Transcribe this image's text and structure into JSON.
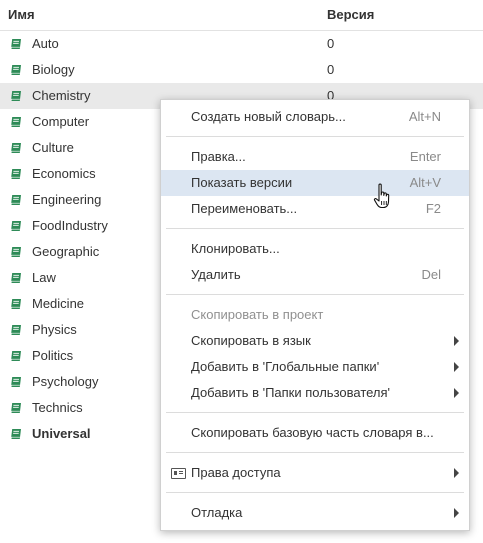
{
  "header": {
    "name_col": "Имя",
    "version_col": "Версия"
  },
  "colors": {
    "book": "#2e8b57",
    "selected_row": "#e9e9e9",
    "highlight": "#dce6f2"
  },
  "rows": [
    {
      "name": "Auto",
      "version": "0"
    },
    {
      "name": "Biology",
      "version": "0"
    },
    {
      "name": "Chemistry",
      "version": "0",
      "selected": true
    },
    {
      "name": "Computer",
      "version": ""
    },
    {
      "name": "Culture",
      "version": ""
    },
    {
      "name": "Economics",
      "version": ""
    },
    {
      "name": "Engineering",
      "version": ""
    },
    {
      "name": "FoodIndustry",
      "version": ""
    },
    {
      "name": "Geographic",
      "version": ""
    },
    {
      "name": "Law",
      "version": ""
    },
    {
      "name": "Medicine",
      "version": ""
    },
    {
      "name": "Physics",
      "version": ""
    },
    {
      "name": "Politics",
      "version": ""
    },
    {
      "name": "Psychology",
      "version": ""
    },
    {
      "name": "Technics",
      "version": ""
    },
    {
      "name": "Universal",
      "version": "",
      "bold": true
    }
  ],
  "menu": {
    "create": {
      "label": "Создать новый словарь...",
      "shortcut": "Alt+N"
    },
    "edit": {
      "label": "Правка...",
      "shortcut": "Enter"
    },
    "show_versions": {
      "label": "Показать версии",
      "shortcut": "Alt+V"
    },
    "rename": {
      "label": "Переименовать...",
      "shortcut": "F2"
    },
    "clone": {
      "label": "Клонировать..."
    },
    "delete": {
      "label": "Удалить",
      "shortcut": "Del"
    },
    "copy_to_project": {
      "label": "Скопировать в проект"
    },
    "copy_to_language": {
      "label": "Скопировать в язык"
    },
    "add_global": {
      "label": "Добавить в 'Глобальные папки'"
    },
    "add_user": {
      "label": "Добавить в 'Папки пользователя'"
    },
    "copy_base": {
      "label": "Скопировать базовую часть словаря в..."
    },
    "access": {
      "label": "Права доступа"
    },
    "debug": {
      "label": "Отладка"
    }
  }
}
